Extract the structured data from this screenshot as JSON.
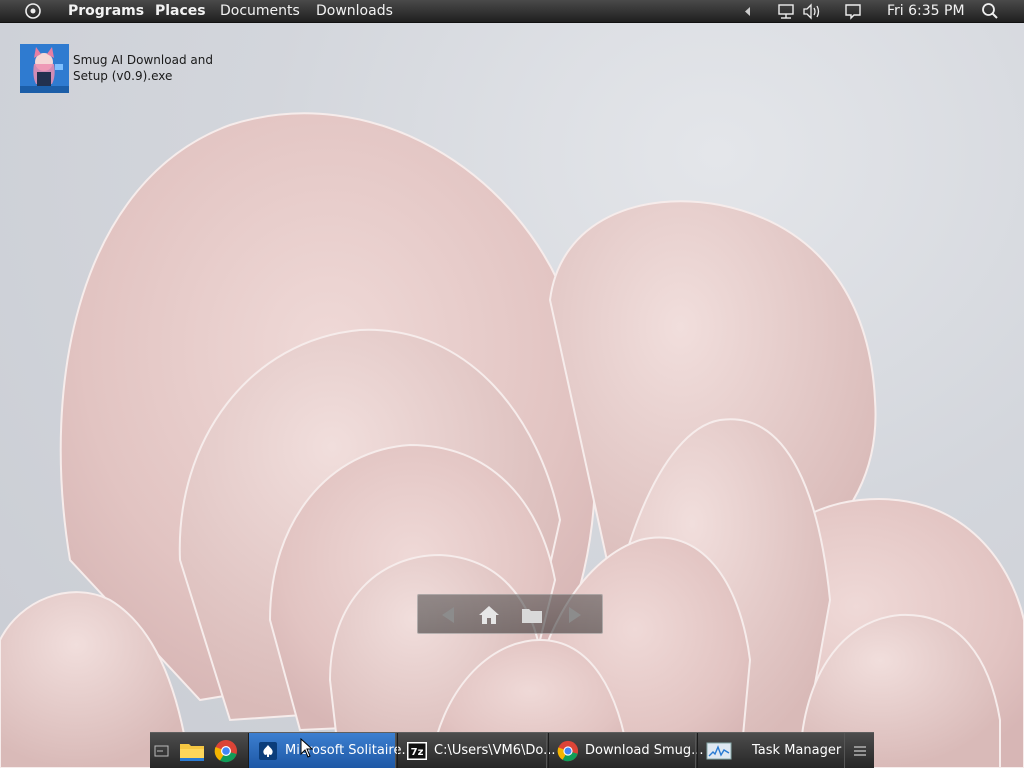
{
  "top_panel": {
    "menu_items": [
      "Programs",
      "Places",
      "Documents",
      "Downloads"
    ],
    "clock": "Fri 6:35 PM",
    "icons": [
      "menu-icon",
      "tray-expand-icon",
      "network-icon",
      "volume-icon",
      "message-icon",
      "search-icon"
    ]
  },
  "desktop": {
    "icon_label": "Smug AI Download and Setup (v0.9).exe",
    "icon_label_line1": "Smug AI Download and",
    "icon_label_line2": "Setup (v0.9).exe"
  },
  "float_nav": {
    "icons": [
      "back-icon",
      "home-icon",
      "folder-icon",
      "forward-icon"
    ]
  },
  "taskbar": {
    "quick_launch": [
      "show-desktop-icon",
      "file-explorer-icon",
      "chrome-icon"
    ],
    "tasks": [
      {
        "label": "Microsoft Solitaire...",
        "icon": "solitaire-icon",
        "active": true
      },
      {
        "label": "C:\\Users\\VM6\\Do...",
        "icon": "7zip-icon",
        "active": false
      },
      {
        "label": "Download Smug...",
        "icon": "chrome-icon",
        "active": false
      },
      {
        "label": "Task Manager",
        "icon": "task-manager-icon",
        "active": false
      }
    ],
    "menu_icon": "taskbar-menu-icon"
  },
  "colors": {
    "panel": "#2b2b2b",
    "active_task": "#2a6cc0",
    "wallpaper_petal": "#e8cfcd"
  }
}
